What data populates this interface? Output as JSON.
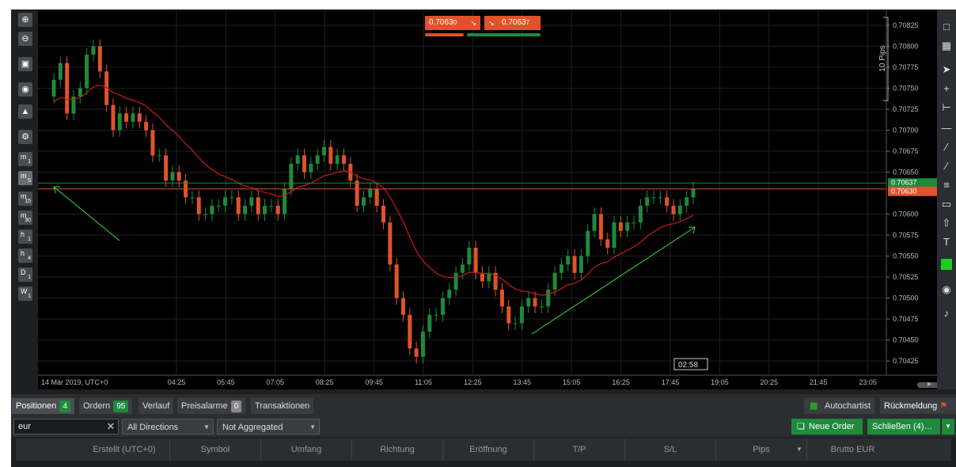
{
  "toolbar_left": {
    "timeframes": [
      {
        "main": "m",
        "sub": "1"
      },
      {
        "main": "m",
        "sub": "5"
      },
      {
        "main": "m",
        "sub": "15"
      },
      {
        "main": "m",
        "sub": "30"
      },
      {
        "main": "h",
        "sub": "1"
      },
      {
        "main": "h",
        "sub": "4"
      },
      {
        "main": "D",
        "sub": "1"
      },
      {
        "main": "W",
        "sub": "1"
      }
    ],
    "active_timeframe_index": 1,
    "icons": [
      "zoom-in-icon",
      "zoom-out-icon",
      "indicators-icon",
      "chart-type-icon",
      "trader-icon",
      "settings-icon"
    ]
  },
  "quote": {
    "sell_price": "0.7063",
    "sell_pip": "0",
    "buy_price": "0.7063",
    "buy_pip": "7",
    "sell_color": "#e0532a",
    "buy_color": "#1e8a3c"
  },
  "chart": {
    "pips_label": "10 Pips",
    "y_ticks": [
      "0.70825",
      "0.70800",
      "0.70775",
      "0.70750",
      "0.70725",
      "0.70700",
      "0.70675",
      "0.70650",
      "0.70600",
      "0.70575",
      "0.70550",
      "0.70525",
      "0.70500",
      "0.70475",
      "0.70450",
      "0.70425"
    ],
    "x_ticks": [
      "14 Mär 2019, UTC+0",
      "04:25",
      "05:45",
      "07:05",
      "08:25",
      "09:45",
      "11:05",
      "12:25",
      "13:45",
      "15:05",
      "16:25",
      "17:45",
      "19:05",
      "20:25",
      "21:45",
      "23:05"
    ],
    "ask_label": "0.70637",
    "bid_label": "0.70630",
    "countdown": "02:58",
    "up_color": "#1e8a3c",
    "down_color": "#e0532a",
    "ma_color": "#cc1a1a"
  },
  "chart_data": {
    "type": "candlestick",
    "ylim": [
      0.7041,
      0.7084
    ],
    "ask_line": 0.70637,
    "bid_line": 0.7063,
    "close": [
      0.7076,
      0.7078,
      0.7072,
      0.7074,
      0.7075,
      0.7079,
      0.708,
      0.7077,
      0.7073,
      0.707,
      0.7072,
      0.7071,
      0.7072,
      0.7071,
      0.707,
      0.7067,
      0.7067,
      0.7064,
      0.7065,
      0.7064,
      0.7062,
      0.7062,
      0.706,
      0.706,
      0.7061,
      0.7061,
      0.7062,
      0.7062,
      0.706,
      0.7061,
      0.7062,
      0.706,
      0.7061,
      0.7061,
      0.706,
      0.7063,
      0.7066,
      0.7067,
      0.7065,
      0.7066,
      0.7067,
      0.7068,
      0.7066,
      0.7067,
      0.7066,
      0.7064,
      0.7061,
      0.7062,
      0.7063,
      0.7061,
      0.7059,
      0.7054,
      0.705,
      0.7048,
      0.7044,
      0.7043,
      0.7046,
      0.7048,
      0.7048,
      0.705,
      0.7051,
      0.7053,
      0.7054,
      0.7056,
      0.7053,
      0.7052,
      0.7053,
      0.7051,
      0.7049,
      0.7047,
      0.7047,
      0.7049,
      0.705,
      0.7049,
      0.7049,
      0.7051,
      0.7053,
      0.7054,
      0.7055,
      0.7053,
      0.7055,
      0.7058,
      0.706,
      0.7057,
      0.7056,
      0.7059,
      0.7058,
      0.7059,
      0.7059,
      0.7061,
      0.7062,
      0.7062,
      0.7062,
      0.7061,
      0.706,
      0.7061,
      0.7062,
      0.7063
    ]
  },
  "tabs": [
    {
      "label": "Positionen",
      "count": "4"
    },
    {
      "label": "Ordern",
      "count": "95"
    },
    {
      "label": "Verlauf",
      "count": ""
    },
    {
      "label": "Preisalarme",
      "count": "0"
    },
    {
      "label": "Transaktionen",
      "count": ""
    }
  ],
  "right_tabs": {
    "autochartist": "Autochartist",
    "feedback": "Rückmeldung"
  },
  "filter": {
    "search_value": "eur",
    "directions": "All Directions (St…",
    "aggregation": "Not Aggregated (St…",
    "new_order": "Neue Order",
    "close_all": "Schließen (4)…"
  },
  "table": {
    "columns": [
      "Erstellt (UTC+0)",
      "Symbol",
      "Umfang",
      "Richtung",
      "Eröffnung",
      "T/P",
      "S/L",
      "Pips",
      "Brutto EUR"
    ]
  }
}
